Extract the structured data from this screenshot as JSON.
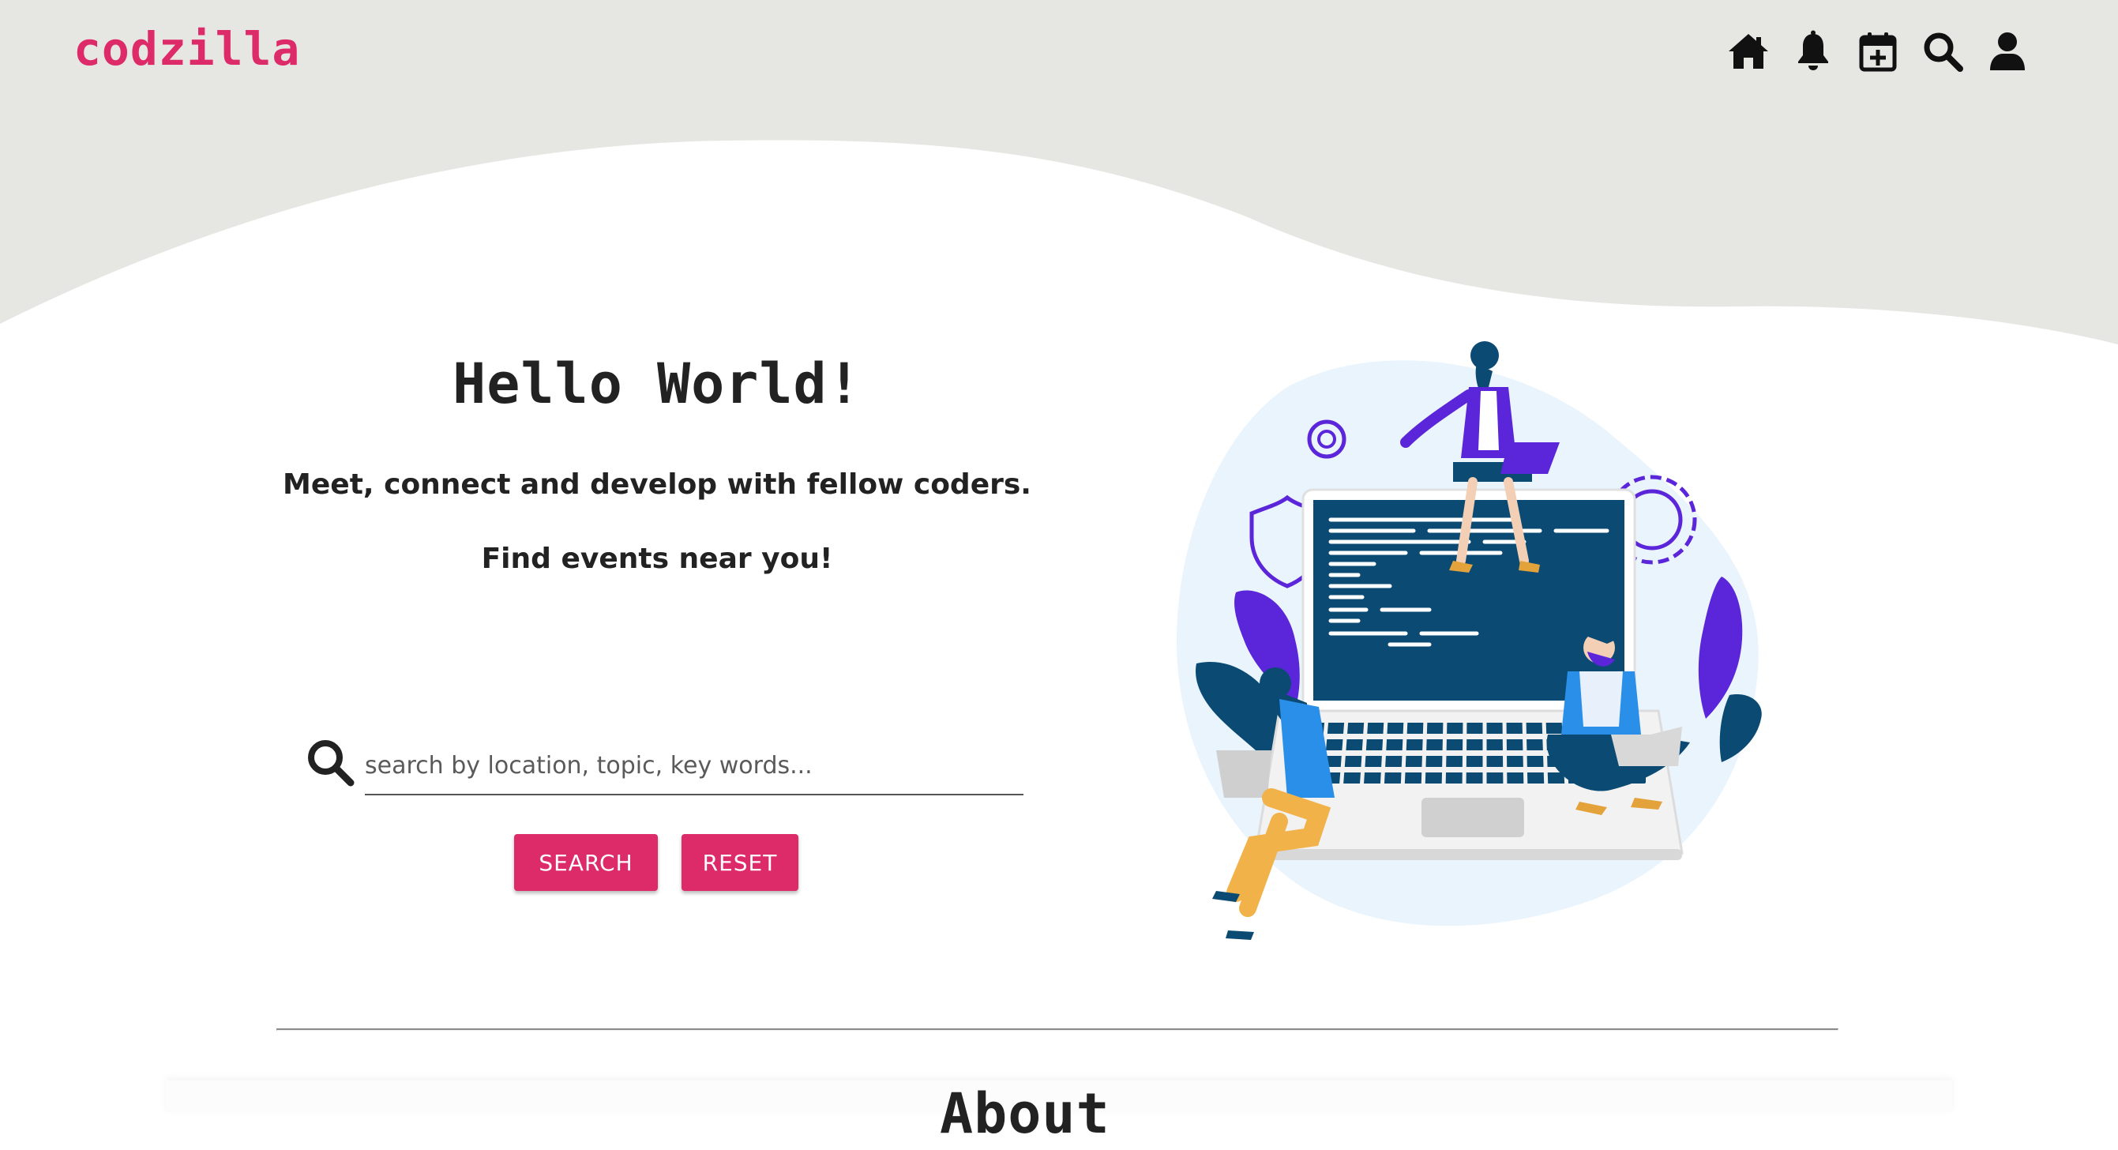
{
  "header": {
    "logo": "codzilla",
    "nav": [
      {
        "name": "home-icon"
      },
      {
        "name": "bell-icon"
      },
      {
        "name": "calendar-plus-icon"
      },
      {
        "name": "search-icon"
      },
      {
        "name": "user-icon"
      }
    ]
  },
  "hero": {
    "title": "Hello World!",
    "tagline": "Meet, connect and develop with fellow coders.",
    "subtitle": "Find events near you!",
    "search_placeholder": "search by location, topic, key words...",
    "search_value": "",
    "search_button": "SEARCH",
    "reset_button": "RESET"
  },
  "about": {
    "title": "About"
  },
  "colors": {
    "brand": "#dd2a68",
    "header_bg": "#e6e7e2",
    "text": "#222222",
    "illustration_navy": "#0a4a73",
    "illustration_purple": "#5b25d9",
    "illustration_blue": "#2a8fe8"
  },
  "illustration": {
    "name": "coders-at-laptop-illustration"
  }
}
